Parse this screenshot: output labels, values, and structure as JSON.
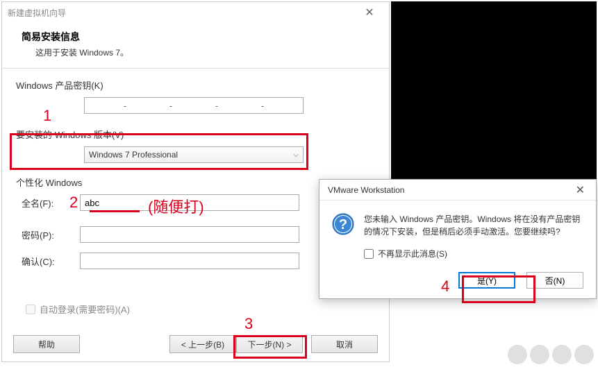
{
  "wizard": {
    "title": "新建虚拟机向导",
    "header_title": "简易安装信息",
    "header_sub": "这用于安装 Windows 7。",
    "product_key_label": "Windows 产品密钥(K)",
    "version_label": "要安装的 Windows 版本(V)",
    "version_value": "Windows 7 Professional",
    "personalize_label": "个性化 Windows",
    "fullname_label": "全名(F):",
    "fullname_value": "abc",
    "password_label": "密码(P):",
    "password_value": "",
    "confirm_label": "确认(C):",
    "confirm_value": "",
    "auto_login_label": "自动登录(需要密码)(A)",
    "help_btn": "帮助",
    "back_btn": "< 上一步(B)",
    "next_btn": "下一步(N) >",
    "cancel_btn": "取消"
  },
  "msgbox": {
    "title": "VMware Workstation",
    "text": "您未输入 Windows 产品密钥。Windows 将在没有产品密钥的情况下安装，但是稍后必须手动激活。您要继续吗?",
    "suppress_label": "不再显示此消息(S)",
    "yes_btn": "是(Y)",
    "no_btn": "否(N)"
  },
  "annotations": {
    "n1": "1",
    "n2": "2",
    "n3": "3",
    "n4": "4",
    "note": "(随便打)"
  }
}
